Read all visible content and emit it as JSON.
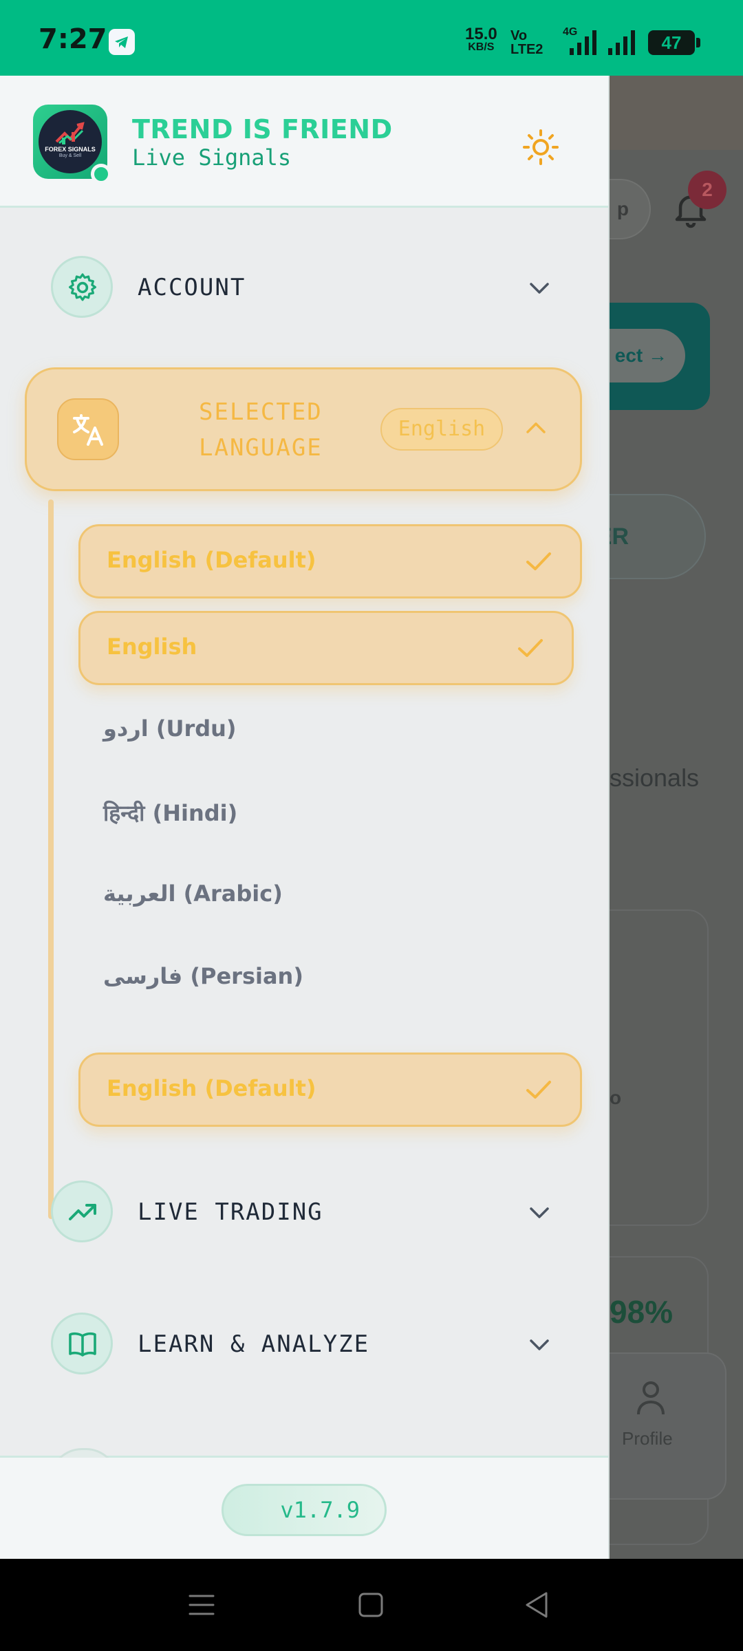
{
  "status_bar": {
    "time": "7:27",
    "net_speed_value": "15.0",
    "net_speed_unit": "KB/S",
    "volte": "Vo",
    "volte_sub": "LTE2",
    "network_type": "4G",
    "battery_level": "47"
  },
  "drawer": {
    "brand": {
      "title": "TREND IS FRIEND",
      "subtitle": "Live Signals",
      "logo_text": "FOREX SIGNALS",
      "logo_subtext": "Buy & Sell"
    },
    "theme_toggle_icon": "sun-icon",
    "menu": {
      "account": {
        "label": "ACCOUNT",
        "icon": "gear-icon"
      },
      "language": {
        "label": "SELECTED LANGUAGE",
        "current": "English",
        "icon": "translate-icon",
        "options": [
          {
            "label": "English (Default)",
            "selected": true
          },
          {
            "label": "English",
            "selected": true
          },
          {
            "label": "اردو (Urdu)",
            "selected": false
          },
          {
            "label": "हिन्दी (Hindi)",
            "selected": false
          },
          {
            "label": "العربية (Arabic)",
            "selected": false
          },
          {
            "label": "فارسی (Persian)",
            "selected": false
          },
          {
            "label": "English (Default)",
            "selected": true
          }
        ]
      },
      "live_trading": {
        "label": "LIVE TRADING",
        "icon": "trending-up-icon"
      },
      "learn_analyze": {
        "label": "LEARN & ANALYZE",
        "icon": "book-icon"
      }
    },
    "version": "v1.7.9"
  },
  "background_page": {
    "notification_count": "2",
    "pill_text": "p",
    "connect_text": "ect →",
    "chip_text": "ER",
    "partial_text": "ssionals",
    "card_char": "o",
    "percent_text": "98%",
    "profile_label": "Profile"
  },
  "colors": {
    "status_bar": "#00bb84",
    "brand_accent": "#2bcf96",
    "language_accent": "#f5b843",
    "selected_option_bg": "#f2d8b0"
  }
}
